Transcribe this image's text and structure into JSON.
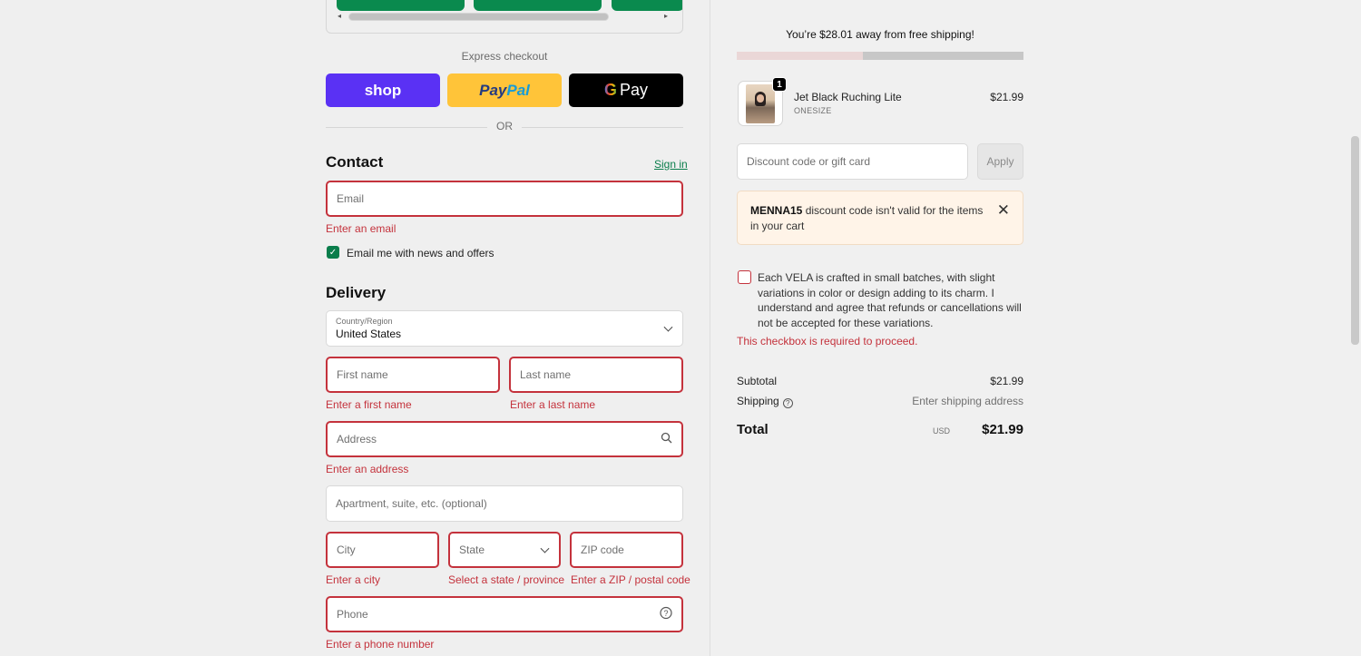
{
  "express": {
    "label": "Express checkout",
    "shop_label": "shop",
    "paypal_label_1": "Pay",
    "paypal_label_2": "Pal",
    "gpay_label_g": "G",
    "gpay_label": "Pay",
    "or_label": "OR"
  },
  "contact": {
    "heading": "Contact",
    "sign_in": "Sign in",
    "email_placeholder": "Email",
    "email_error": "Enter an email",
    "newsletter_label": "Email me with news and offers",
    "newsletter_checked": true
  },
  "delivery": {
    "heading": "Delivery",
    "country_label": "Country/Region",
    "country_value": "United States",
    "first_name_placeholder": "First name",
    "first_name_error": "Enter a first name",
    "last_name_placeholder": "Last name",
    "last_name_error": "Enter a last name",
    "address_placeholder": "Address",
    "address_error": "Enter an address",
    "apartment_placeholder": "Apartment, suite, etc. (optional)",
    "city_placeholder": "City",
    "city_error": "Enter a city",
    "state_placeholder": "State",
    "state_error": "Select a state / province",
    "zip_placeholder": "ZIP code",
    "zip_error": "Enter a ZIP / postal code",
    "phone_placeholder": "Phone",
    "phone_error": "Enter a phone number"
  },
  "summary": {
    "free_shipping_msg": "You’re $28.01 away from free shipping!",
    "free_shipping_progress": 0.44,
    "item": {
      "quantity": "1",
      "name": "Jet Black Ruching Lite",
      "variant": "ONESIZE",
      "price": "$21.99"
    },
    "discount_placeholder": "Discount code or gift card",
    "apply_label": "Apply",
    "alert_code": "MENNA15",
    "alert_text": " discount code isn't valid for the items in your cart",
    "terms_text": "Each VELA is crafted in small batches, with slight variations in color or design adding to its charm. I understand and agree that refunds or cancellations will not be accepted for these variations.",
    "terms_error": "This checkbox is required to proceed.",
    "subtotal_label": "Subtotal",
    "subtotal_value": "$21.99",
    "shipping_label": "Shipping",
    "shipping_value": "Enter shipping address",
    "total_label": "Total",
    "total_currency": "USD",
    "total_value": "$21.99"
  },
  "colors": {
    "error": "#c4323c",
    "accent": "#0a7d4b",
    "shop": "#5a31f4",
    "paypal": "#ffc439"
  }
}
